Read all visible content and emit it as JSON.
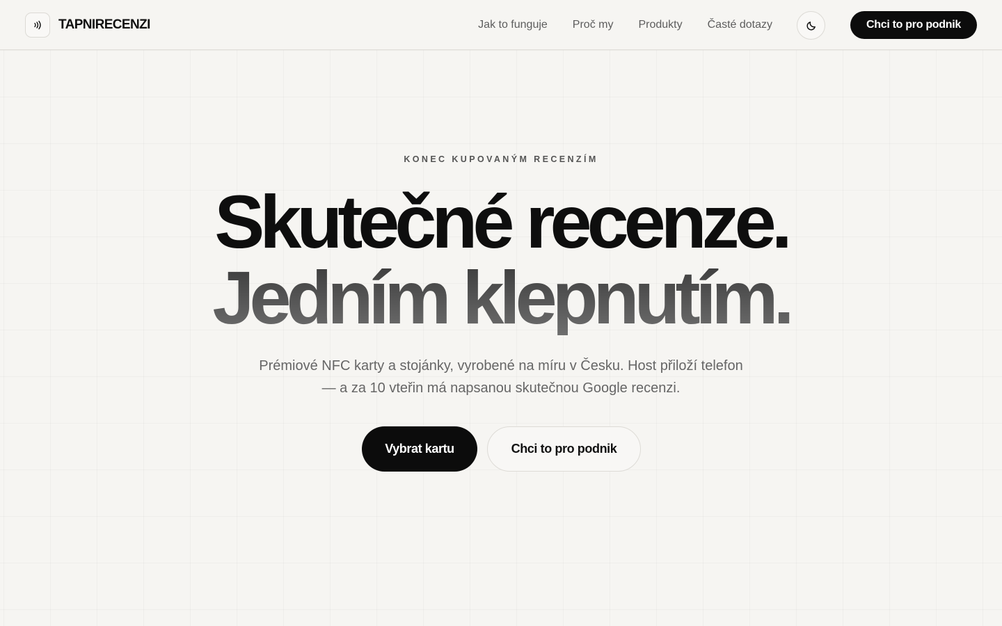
{
  "header": {
    "logo_text": "TAPNIRECENZI",
    "nav": [
      {
        "label": "Jak to funguje"
      },
      {
        "label": "Proč my"
      },
      {
        "label": "Produkty"
      },
      {
        "label": "Časté dotazy"
      }
    ],
    "theme_toggle_icon": "moon-icon",
    "cta_label": "Chci to pro podnik"
  },
  "hero": {
    "eyebrow": "KONEC KUPOVANÝM RECENZÍM",
    "headline_line1": "Skutečné recenze.",
    "headline_line2": "Jedním klepnutím.",
    "subtitle": "Prémiové NFC karty a stojánky, vyrobené na míru v Česku. Host přiloží telefon — a za 10 vteřin má napsanou skutečnou Google recenzi.",
    "primary_button": "Vybrat kartu",
    "secondary_button": "Chci to pro podnik"
  },
  "colors": {
    "background": "#f6f5f2",
    "primary": "#0c0c0c",
    "text_muted": "#666666"
  }
}
